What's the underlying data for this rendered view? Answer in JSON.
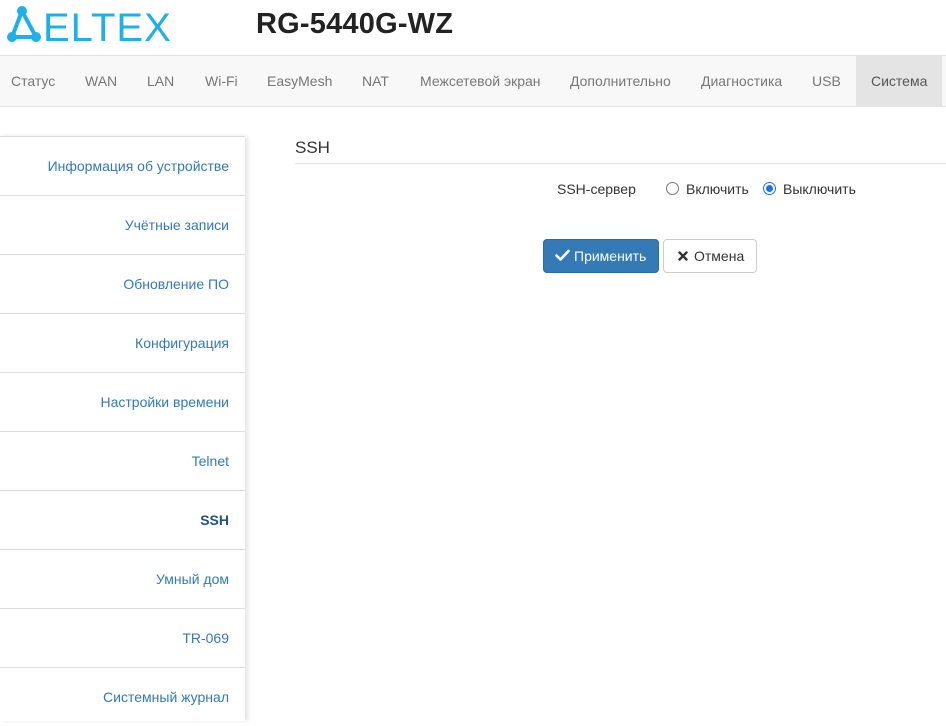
{
  "header": {
    "logo_text": "ELTEX",
    "model": "RG-5440G-WZ",
    "brand_color": "#1eb0e8"
  },
  "topnav": {
    "tabs": [
      {
        "label": "Статус"
      },
      {
        "label": "WAN"
      },
      {
        "label": "LAN"
      },
      {
        "label": "Wi-Fi"
      },
      {
        "label": "EasyMesh"
      },
      {
        "label": "NAT"
      },
      {
        "label": "Межсетевой экран"
      },
      {
        "label": "Дополнительно"
      },
      {
        "label": "Диагностика"
      },
      {
        "label": "USB"
      },
      {
        "label": "Система",
        "active": true
      }
    ]
  },
  "sidebar": {
    "items": [
      {
        "label": "Информация об устройстве"
      },
      {
        "label": "Учётные записи"
      },
      {
        "label": "Обновление ПО"
      },
      {
        "label": "Конфигурация"
      },
      {
        "label": "Настройки времени"
      },
      {
        "label": "Telnet"
      },
      {
        "label": "SSH",
        "active": true
      },
      {
        "label": "Умный дом"
      },
      {
        "label": "TR-069"
      },
      {
        "label": "Системный журнал"
      }
    ]
  },
  "main": {
    "section_title": "SSH",
    "ssh_server": {
      "label": "SSH-сервер",
      "option_enable": "Включить",
      "option_disable": "Выключить",
      "selected": "Выключить"
    },
    "buttons": {
      "apply": "Применить",
      "apply_icon": "check-icon",
      "cancel": "Отмена",
      "cancel_icon": "close-icon"
    }
  },
  "colors": {
    "accent": "#337ab7",
    "link": "#337ab7",
    "active_tab_bg": "#e4e4e4"
  }
}
